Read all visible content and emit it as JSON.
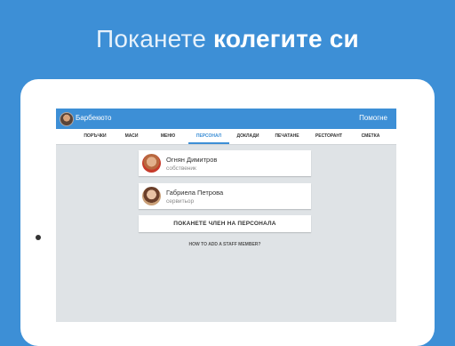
{
  "headline": {
    "light": "Поканете",
    "bold": "колегите си"
  },
  "app": {
    "title": "Барбекюто",
    "help": "Помогне"
  },
  "tabs": [
    {
      "label": "ПОРЪЧКИ"
    },
    {
      "label": "МАСИ"
    },
    {
      "label": "МЕНЮ"
    },
    {
      "label": "ПЕРСОНАЛ",
      "active": true
    },
    {
      "label": "ДОКЛАДИ"
    },
    {
      "label": "ПЕЧАТАНЕ"
    },
    {
      "label": "РЕСТОРАНТ"
    },
    {
      "label": "СМЕТКА"
    }
  ],
  "staff": [
    {
      "name": "Огнян Димитров",
      "role": "собственик"
    },
    {
      "name": "Габриела Петрова",
      "role": "сервитьор"
    }
  ],
  "invite_button": "ПОКАНЕТЕ ЧЛЕН НА ПЕРСОНАЛА",
  "howto_link": "HOW TO ADD A STAFF MEMBER?",
  "colors": {
    "brand": "#3d8fd6",
    "screen_bg": "#dfe3e6"
  }
}
